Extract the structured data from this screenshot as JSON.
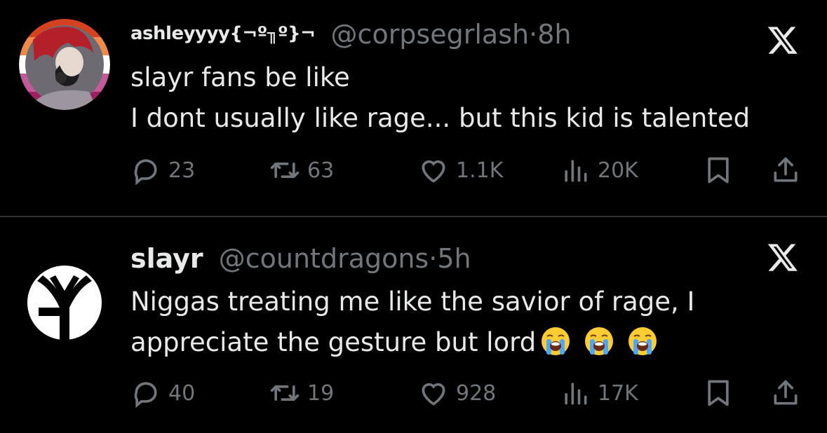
{
  "tweets": [
    {
      "display_name": "ashleyyyy{¬º╖º}¬",
      "handle": "@corpsegrlash",
      "dot": "·",
      "time": "8h",
      "lines": [
        "slayr fans be like",
        "I dont usually like rage... but this kid is talented"
      ],
      "emoji_count": 0,
      "stats": {
        "replies": "23",
        "reposts": "63",
        "likes": "1.1K",
        "views": "20K"
      }
    },
    {
      "display_name": "slayr",
      "handle": "@countdragons",
      "dot": "·",
      "time": "5h",
      "lines": [
        "Niggas treating me like the savior of rage, I",
        "appreciate the gesture but lord"
      ],
      "emoji_count": 3,
      "emoji_name": "loudly-crying-face",
      "stats": {
        "replies": "40",
        "reposts": "19",
        "likes": "928",
        "views": "17K"
      }
    }
  ],
  "icons": {
    "reply": "reply-icon",
    "repost": "repost-icon",
    "like": "like-icon",
    "views": "views-icon",
    "bookmark": "bookmark-icon",
    "share": "share-icon",
    "logo": "x-logo-icon"
  },
  "colors": {
    "background": "#000000",
    "text": "#e7e9ea",
    "muted": "#71767b",
    "divider": "#2f3336"
  }
}
